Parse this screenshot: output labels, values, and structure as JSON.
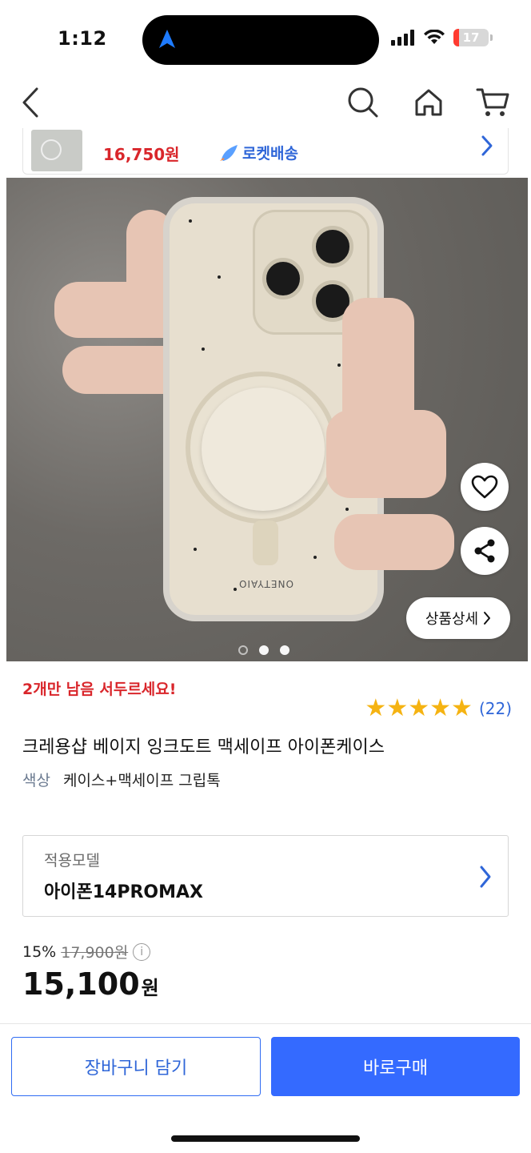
{
  "status_bar": {
    "time": "1:12",
    "battery_level": "17",
    "battery_fraction": 0.17
  },
  "nav": {
    "back_icon": "chevron-left-icon",
    "search_icon": "search-icon",
    "home_icon": "home-icon",
    "cart_icon": "cart-icon"
  },
  "related_product": {
    "price": "16,750원",
    "delivery_badge": "로켓배송"
  },
  "product": {
    "image_dots_count": 3,
    "active_dot_index": 1,
    "detail_button": "상품상세",
    "stock_warning": "2개만 남음 서두르세요!",
    "rating_count": "(22)",
    "rating_value": 5,
    "title": "크레용샵 베이지 잉크도트 맥세이프 아이폰케이스",
    "option_label": "색상",
    "option_value": "케이스+맥세이프 그립톡",
    "brand_text": "ONETYAIO"
  },
  "model_selector": {
    "label": "적용모델",
    "value": "아이폰14PROMAX"
  },
  "pricing": {
    "discount_percent": "15%",
    "original_price": "17,900원",
    "final_amount": "15,100",
    "final_unit": "원"
  },
  "actions": {
    "cart_label": "장바구니 담기",
    "buy_label": "바로구매"
  },
  "colors": {
    "accent": "#346aff",
    "sale_red": "#d9262b",
    "star": "#f5b312"
  }
}
